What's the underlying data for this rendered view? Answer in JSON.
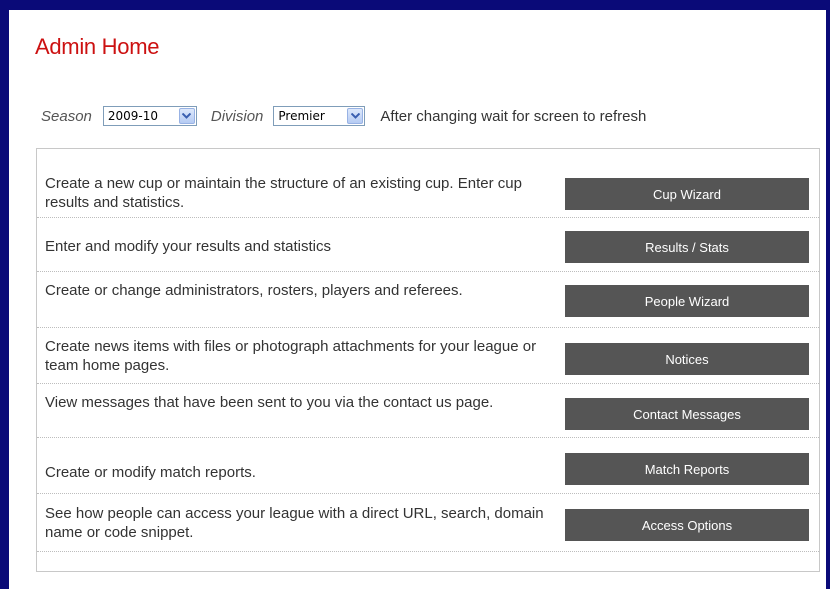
{
  "page": {
    "title": "Admin Home"
  },
  "filters": {
    "season_label": "Season",
    "season_value": "2009-10",
    "division_label": "Division",
    "division_value": "Premier",
    "hint": "After changing wait for screen to refresh"
  },
  "rows": [
    {
      "description": "Create a new cup or maintain the structure of an existing cup. Enter cup results and statistics.",
      "button": "Cup Wizard"
    },
    {
      "description": "Enter and modify your results and statistics",
      "button": "Results / Stats"
    },
    {
      "description": "Create or change administrators, rosters, players and referees.",
      "button": "People Wizard"
    },
    {
      "description": "Create news items with files or photograph attachments for your league or team home pages.",
      "button": "Notices"
    },
    {
      "description": "View messages that have been sent to you via the contact us page.",
      "button": "Contact Messages"
    },
    {
      "description": "Create or modify match reports.",
      "button": "Match Reports"
    },
    {
      "description": "See how people can access your league with a direct URL, search, domain name or code snippet.",
      "button": "Access Options"
    }
  ],
  "icons": {
    "dropdown": "chevron-down-icon"
  },
  "colors": {
    "frame": "#0a0a78",
    "title": "#cc1111",
    "button_bg": "#555555",
    "button_text": "#ffffff"
  }
}
